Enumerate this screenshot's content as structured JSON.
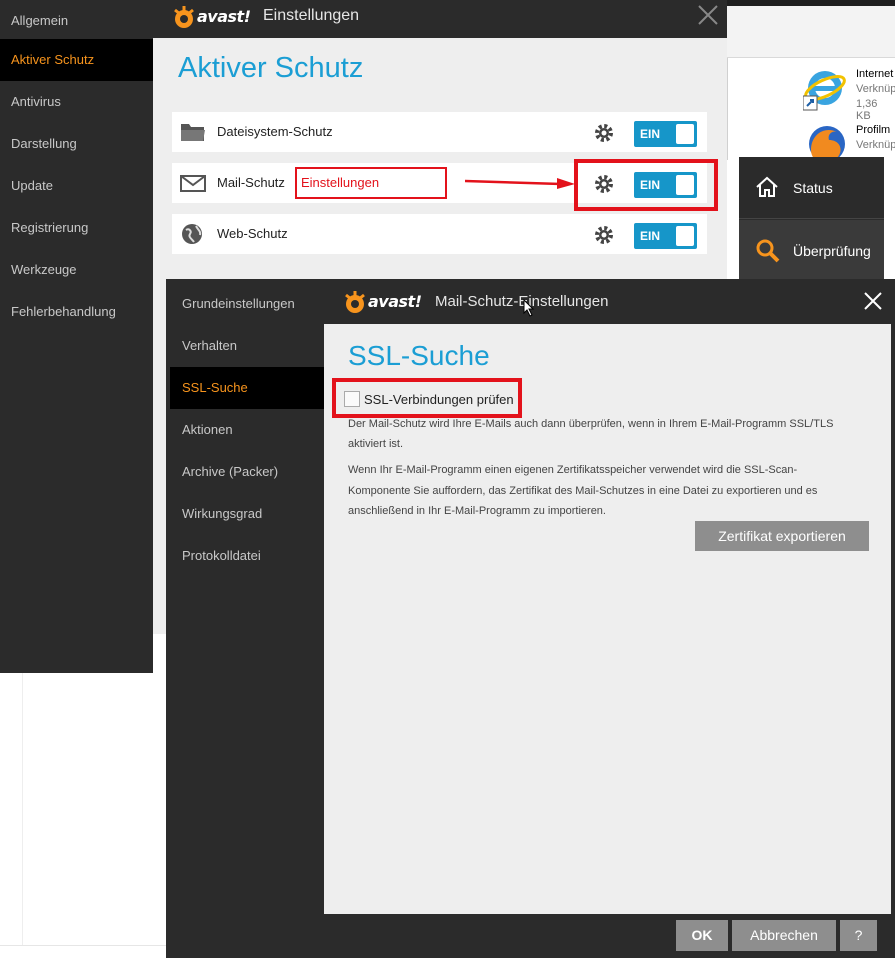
{
  "main_window": {
    "title": "Einstellungen",
    "logo_text": "avast!",
    "nav": [
      {
        "label": "Allgemein"
      },
      {
        "label": "Aktiver Schutz",
        "active": true
      },
      {
        "label": "Antivirus"
      },
      {
        "label": "Darstellung"
      },
      {
        "label": "Update"
      },
      {
        "label": "Registrierung"
      },
      {
        "label": "Werkzeuge"
      },
      {
        "label": "Fehlerbehandlung"
      }
    ],
    "heading": "Aktiver Schutz",
    "shields": [
      {
        "label": "Dateisystem-Schutz",
        "icon": "folder-icon",
        "toggle": "EIN"
      },
      {
        "label": "Mail-Schutz",
        "icon": "envelope-icon",
        "toggle": "EIN"
      },
      {
        "label": "Web-Schutz",
        "icon": "globe-icon",
        "toggle": "EIN"
      }
    ],
    "annotation_label": "Einstellungen"
  },
  "right_window": {
    "files": [
      {
        "name": "Internet",
        "sub1": "Verknüp",
        "sub2": "1,36 KB",
        "icon": "ie-icon"
      },
      {
        "name": "Profilm",
        "sub1": "Verknüp",
        "icon": "firefox-icon"
      }
    ],
    "panel": [
      {
        "label": "Status",
        "icon": "home-icon"
      },
      {
        "label": "Überprüfung",
        "icon": "search-icon"
      }
    ]
  },
  "dialog": {
    "title": "Mail-Schutz-Einstellungen",
    "logo_text": "avast!",
    "nav": [
      {
        "label": "Grundeinstellungen"
      },
      {
        "label": "Verhalten"
      },
      {
        "label": "SSL-Suche",
        "active": true
      },
      {
        "label": "Aktionen"
      },
      {
        "label": "Archive (Packer)"
      },
      {
        "label": "Wirkungsgrad"
      },
      {
        "label": "Protokolldatei"
      }
    ],
    "heading": "SSL-Suche",
    "checkbox_label": "SSL-Verbindungen prüfen",
    "checkbox_checked": false,
    "desc1_line1": "Der Mail-Schutz wird Ihre E-Mails auch dann überprüfen, wenn in Ihrem E-Mail-Programm SSL/TLS",
    "desc1_line2": "aktiviert ist.",
    "desc2_line1": "Wenn Ihr E-Mail-Programm einen eigenen Zertifikatsspeicher verwendet wird die SSL-Scan-",
    "desc2_line2": "Komponente Sie auffordern, das Zertifikat des Mail-Schutzes in eine Datei zu exportieren und es",
    "desc2_line3": "anschließend in Ihr E-Mail-Programm zu importieren.",
    "export_button": "Zertifikat exportieren",
    "ok_button": "OK",
    "cancel_button": "Abbrechen",
    "help_button": "?"
  },
  "colors": {
    "accent_blue": "#1b9ed4",
    "toggle_blue": "#1696c9",
    "nav_active": "#f7941d",
    "callout_red": "#e3121b",
    "dark_bg": "#2b2b2b"
  }
}
